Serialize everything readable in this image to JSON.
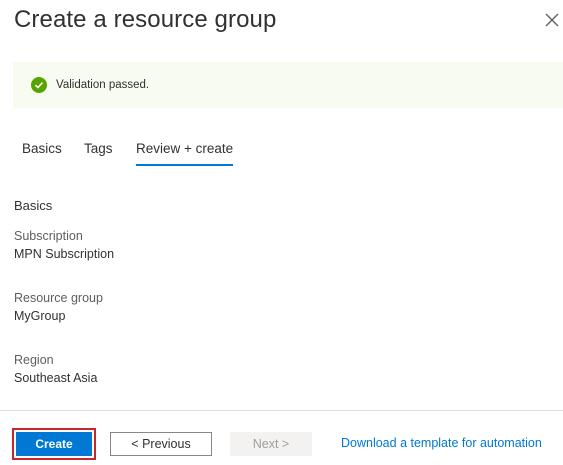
{
  "header": {
    "title": "Create a resource group",
    "close_icon": "close-icon"
  },
  "banner": {
    "icon": "check-circle-icon",
    "message": "Validation passed.",
    "background": "#f8fbef",
    "icon_color": "#57a300"
  },
  "tabs": [
    {
      "label": "Basics",
      "active": false
    },
    {
      "label": "Tags",
      "active": false
    },
    {
      "label": "Review + create",
      "active": true
    }
  ],
  "review": {
    "section_title": "Basics",
    "fields": [
      {
        "label": "Subscription",
        "value": "MPN Subscription"
      },
      {
        "label": "Resource group",
        "value": "MyGroup"
      },
      {
        "label": "Region",
        "value": "Southeast Asia"
      }
    ]
  },
  "footer": {
    "create_label": "Create",
    "previous_label": "< Previous",
    "next_label": "Next >",
    "download_link": "Download a template for automation"
  },
  "colors": {
    "accent": "#0078d4",
    "highlight_border": "#c4262e"
  }
}
